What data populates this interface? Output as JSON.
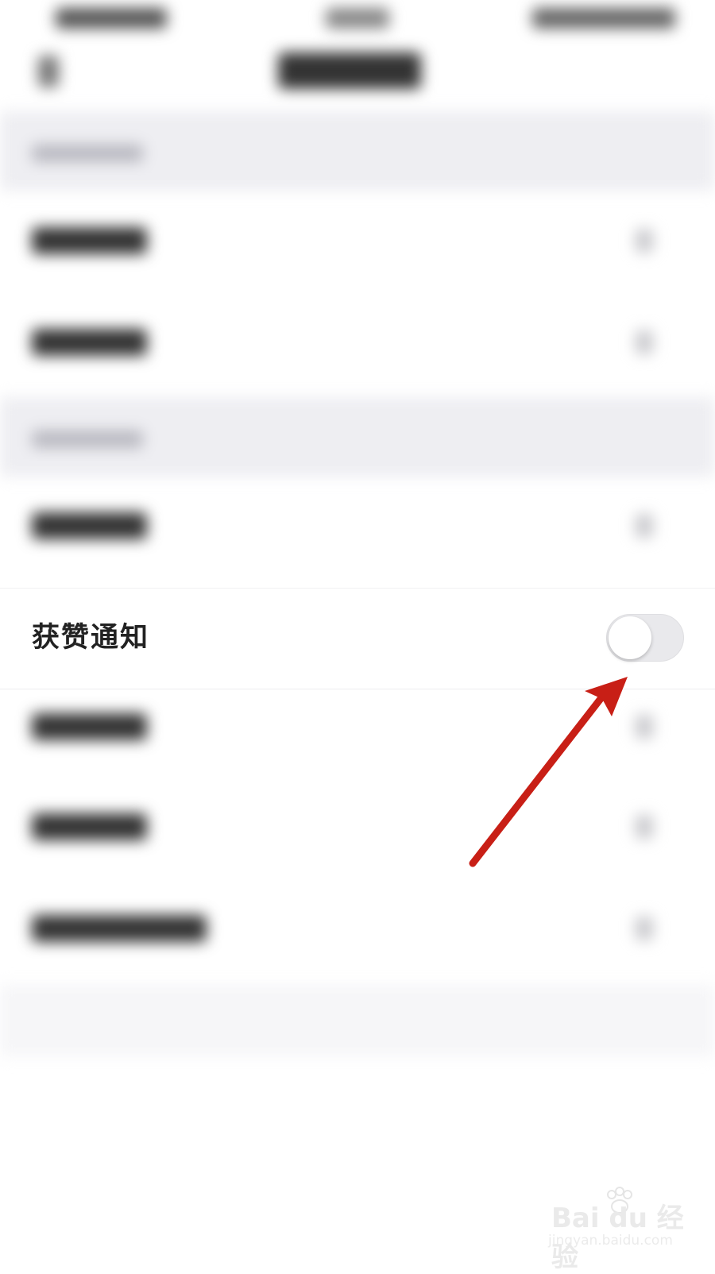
{
  "setting": {
    "label": "获赞通知",
    "toggle_on": false
  },
  "watermark": {
    "brand": "Bai du 经验",
    "url": "jingyan.baidu.com"
  },
  "colors": {
    "annotation_arrow": "#c81f16",
    "toggle_track_off": "#e9e9ec",
    "section_header_bg": "#eeeef2"
  },
  "icons": {
    "back": "chevron-left-icon",
    "row_chevron": "chevron-right-icon",
    "annotation": "red-arrow-icon",
    "watermark_logo": "paw-icon"
  }
}
